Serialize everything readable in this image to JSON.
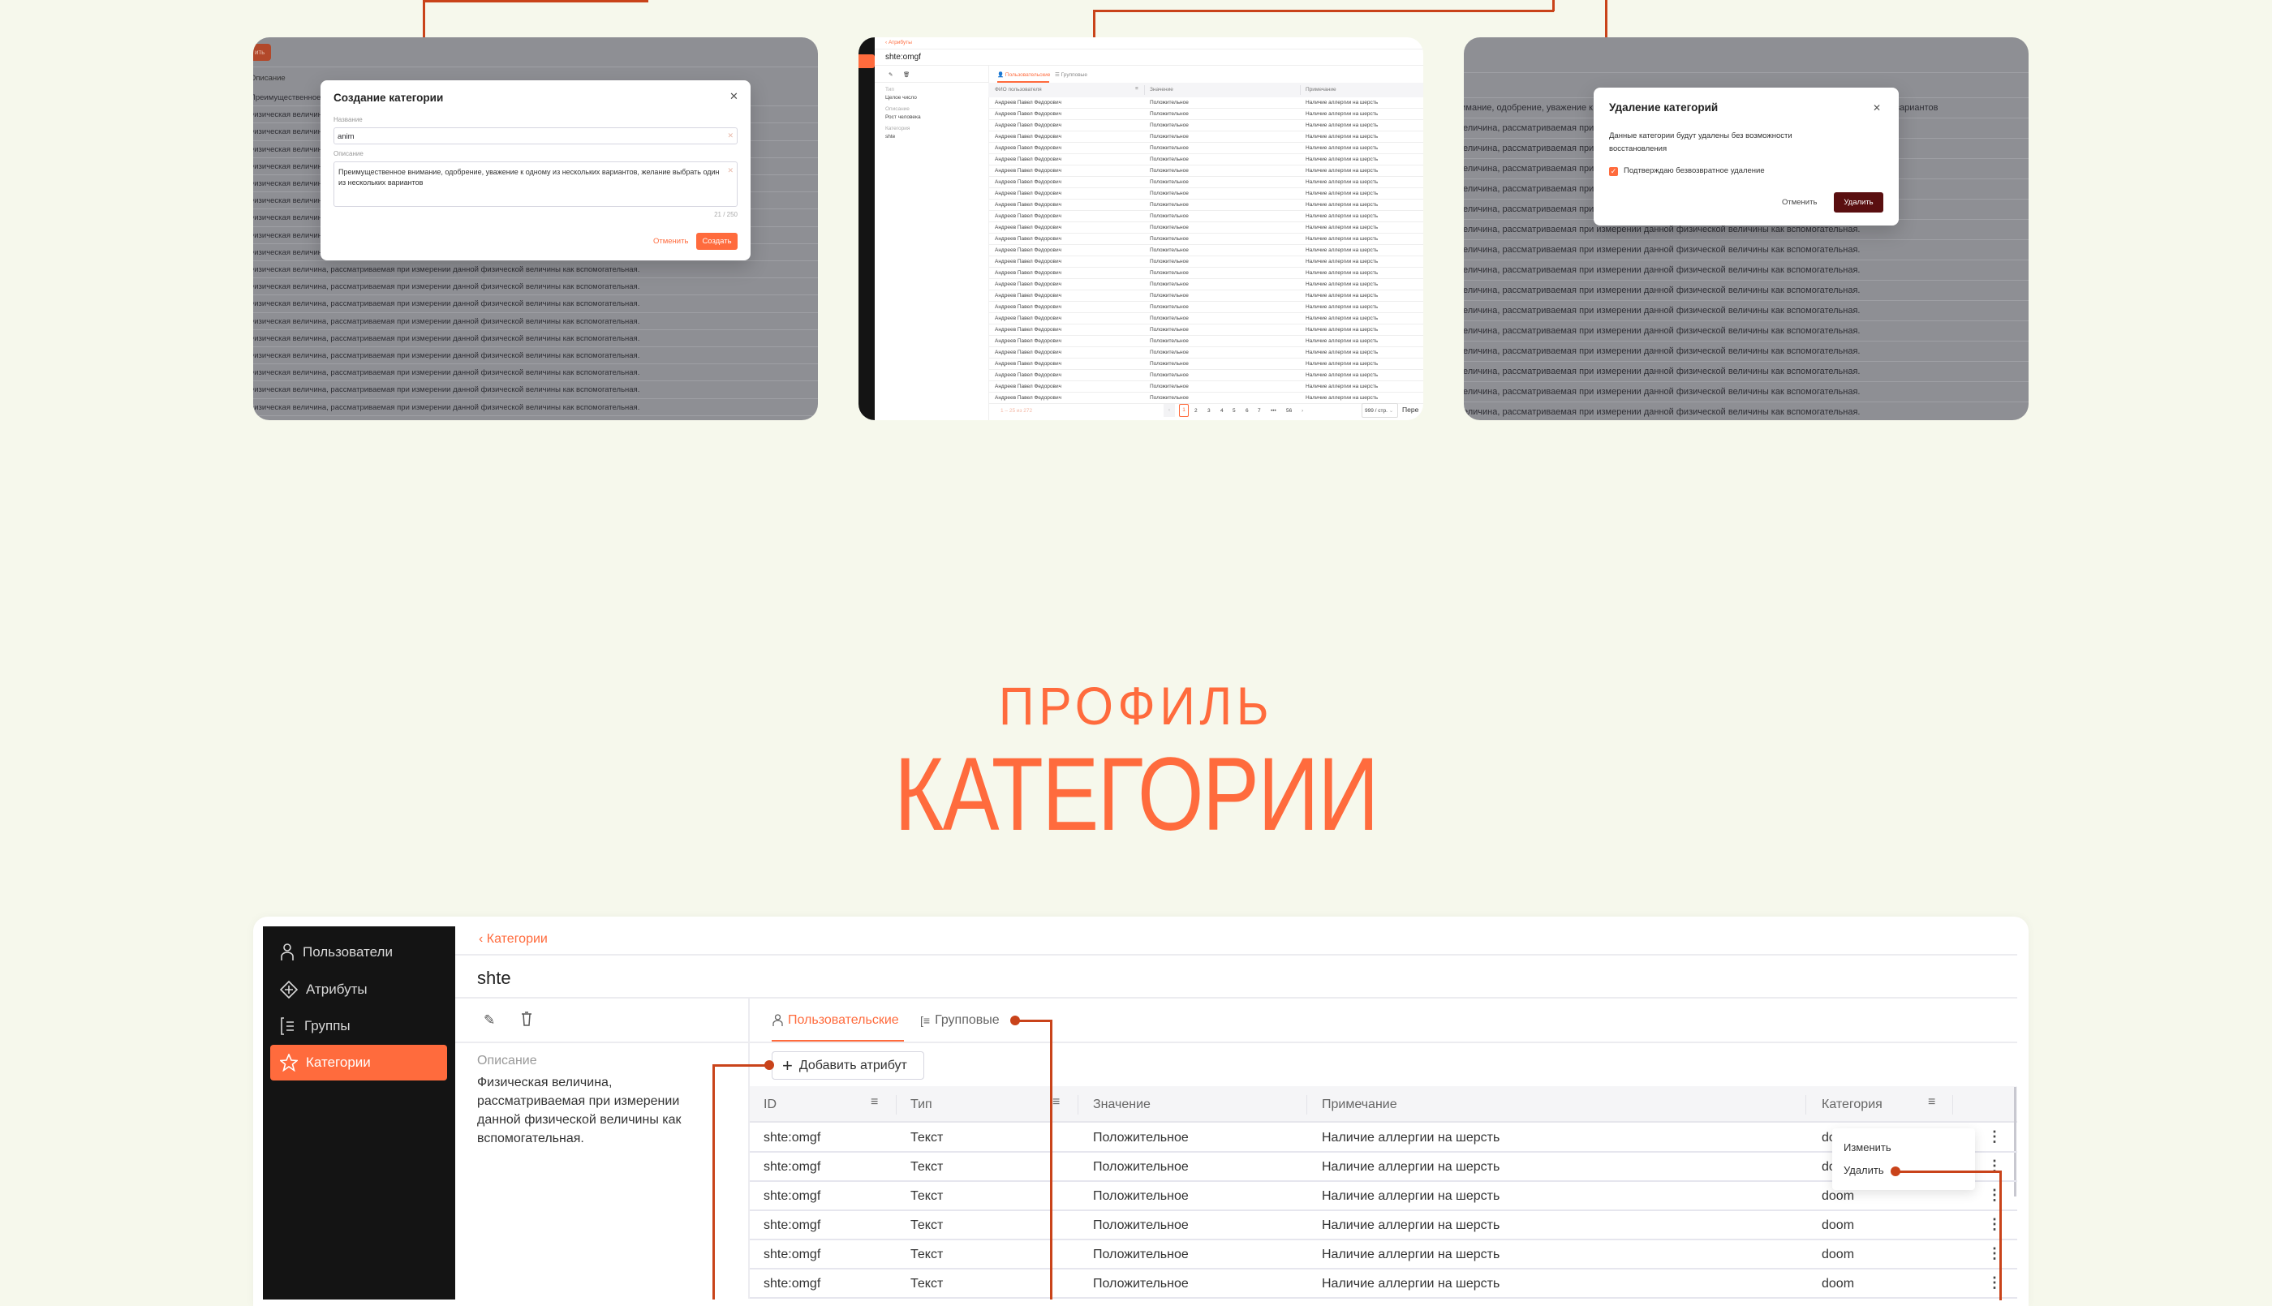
{
  "colors": {
    "accent": "#ff6b3d",
    "annotation": "#c9431a",
    "danger": "#5a0f10",
    "sidebar": "#141414",
    "background": "#f6f8ec"
  },
  "preview_create": {
    "bg_button_fragment": "ить",
    "bg_header": "Описание",
    "bg_rows": [
      "Преимущественное внимание, одобрение, уважение к одному из нескольких вариантов, желание выбрать один из нескольких вариантов",
      "Физическая величина, рассматриваемая при измерении данной физической величины как вспомогательная.",
      "Физическая величина, рассматриваемая при измерении данной физической величины как вспомогательная.",
      "Физическая величина, рассматриваемая при измерении данной физической величины как вспомогательная.",
      "Физическая величина, рассматриваемая при измерении данной физической величины как вспомогательная.",
      "Физическая величина, рассматриваемая при измерении данной физической величины как вспомогательная.",
      "Физическая величина, рассматриваемая при измерении данной физической величины как вспомогательная.",
      "Физическая величина, рассматриваемая при измерении данной физической величины как вспомогательная.",
      "Физическая величина, рассматриваемая при измерении данной физической величины как вспомогательная.",
      "Физическая величина, рассматриваемая при измерении данной физической величины как вспомогательная.",
      "Физическая величина, рассматриваемая при измерении данной физической величины как вспомогательная.",
      "Физическая величина, рассматриваемая при измерении данной физической величины как вспомогательная.",
      "Физическая величина, рассматриваемая при измерении данной физической величины как вспомогательная.",
      "Физическая величина, рассматриваемая при измерении данной физической величины как вспомогательная.",
      "Физическая величина, рассматриваемая при измерении данной физической величины как вспомогательная.",
      "Физическая величина, рассматриваемая при измерении данной физической величины как вспомогательная.",
      "Физическая величина, рассматриваемая при измерении данной физической величины как вспомогательная.",
      "Физическая величина, рассматриваемая при измерении данной физической величины как вспомогательная.",
      "Физическая величина, рассматриваемая при измерении данной физической величины как вспомогательная."
    ],
    "modal": {
      "title": "Создание категории",
      "name_label": "Название",
      "name_value": "anim",
      "desc_label": "Описание",
      "desc_value": "Преимущественное внимание, одобрение, уважение к одному из нескольких вариантов, желание выбрать один из нескольких вариантов",
      "counter": "21 / 250",
      "cancel": "Отменить",
      "create": "Создать"
    }
  },
  "preview_attribute": {
    "breadcrumb": "Атрибуты",
    "title": "shte:omgf",
    "details": [
      {
        "label": "Тип",
        "value": "Целое число"
      },
      {
        "label": "Описание",
        "value": "Рост человека"
      },
      {
        "label": "Категория",
        "value": "shte"
      }
    ],
    "tabs": [
      "Пользовательские",
      "Групповые"
    ],
    "columns": [
      "ФИО пользователя",
      "Значение",
      "Примечание"
    ],
    "rows": [
      [
        "Андреев Павел Федорович",
        "Положительное",
        "Наличие аллергии на шерсть"
      ],
      [
        "Андреев Павел Федорович",
        "Положительное",
        "Наличие аллергии на шерсть"
      ],
      [
        "Андреев Павел Федорович",
        "Положительное",
        "Наличие аллергии на шерсть"
      ],
      [
        "Андреев Павел Федорович",
        "Положительное",
        "Наличие аллергии на шерсть"
      ],
      [
        "Андреев Павел Федорович",
        "Положительное",
        "Наличие аллергии на шерсть"
      ],
      [
        "Андреев Павел Федорович",
        "Положительное",
        "Наличие аллергии на шерсть"
      ],
      [
        "Андреев Павел Федорович",
        "Положительное",
        "Наличие аллергии на шерсть"
      ],
      [
        "Андреев Павел Федорович",
        "Положительное",
        "Наличие аллергии на шерсть"
      ],
      [
        "Андреев Павел Федорович",
        "Положительное",
        "Наличие аллергии на шерсть"
      ],
      [
        "Андреев Павел Федорович",
        "Положительное",
        "Наличие аллергии на шерсть"
      ],
      [
        "Андреев Павел Федорович",
        "Положительное",
        "Наличие аллергии на шерсть"
      ],
      [
        "Андреев Павел Федорович",
        "Положительное",
        "Наличие аллергии на шерсть"
      ],
      [
        "Андреев Павел Федорович",
        "Положительное",
        "Наличие аллергии на шерсть"
      ],
      [
        "Андреев Павел Федорович",
        "Положительное",
        "Наличие аллергии на шерсть"
      ],
      [
        "Андреев Павел Федорович",
        "Положительное",
        "Наличие аллергии на шерсть"
      ],
      [
        "Андреев Павел Федорович",
        "Положительное",
        "Наличие аллергии на шерсть"
      ],
      [
        "Андреев Павел Федорович",
        "Положительное",
        "Наличие аллергии на шерсть"
      ],
      [
        "Андреев Павел Федорович",
        "Положительное",
        "Наличие аллергии на шерсть"
      ],
      [
        "Андреев Павел Федорович",
        "Положительное",
        "Наличие аллергии на шерсть"
      ],
      [
        "Андреев Павел Федорович",
        "Положительное",
        "Наличие аллергии на шерсть"
      ],
      [
        "Андреев Павел Федорович",
        "Положительное",
        "Наличие аллергии на шерсть"
      ],
      [
        "Андреев Павел Федорович",
        "Положительное",
        "Наличие аллергии на шерсть"
      ],
      [
        "Андреев Павел Федорович",
        "Положительное",
        "Наличие аллергии на шерсть"
      ],
      [
        "Андреев Павел Федорович",
        "Положительное",
        "Наличие аллергии на шерсть"
      ],
      [
        "Андреев Павел Федорович",
        "Положительное",
        "Наличие аллергии на шерсть"
      ],
      [
        "Андреев Павел Федорович",
        "Положительное",
        "Наличие аллергии на шерсть"
      ],
      [
        "Андреев Павел Федорович",
        "Положительное",
        "Наличие аллергии на шерсть"
      ]
    ],
    "pagination": {
      "summary": "1 – 25 из 272",
      "pages": [
        "1",
        "2",
        "3",
        "4",
        "5",
        "6",
        "7",
        "•••",
        "56"
      ],
      "current": "1",
      "page_size": "999 / стр.",
      "goto": "Пере"
    }
  },
  "preview_delete": {
    "bg_rows": [
      "Преимущественное внимание, одобрение, уважение к одному из нескольких вариантов, желание выбрать один из нескольких вариантов",
      "Физическая величина, рассматриваемая при измерении данной физической величины как вспомогательная.",
      "Физическая величина, рассматриваемая при измерении данной физической величины как вспомогательная.",
      "Физическая величина, рассматриваемая при измерении данной физической величины как вспомогательная.",
      "Физическая величина, рассматриваемая при измерении данной физической величины как вспомогательная.",
      "Физическая величина, рассматриваемая при измерении данной физической величины как вспомогательная.",
      "Физическая величина, рассматриваемая при измерении данной физической величины как вспомогательная.",
      "Физическая величина, рассматриваемая при измерении данной физической величины как вспомогательная.",
      "Физическая величина, рассматриваемая при измерении данной физической величины как вспомогательная.",
      "Физическая величина, рассматриваемая при измерении данной физической величины как вспомогательная.",
      "Физическая величина, рассматриваемая при измерении данной физической величины как вспомогательная.",
      "Физическая величина, рассматриваемая при измерении данной физической величины как вспомогательная.",
      "Физическая величина, рассматриваемая при измерении данной физической величины как вспомогательная.",
      "Физическая величина, рассматриваемая при измерении данной физической величины как вспомогательная.",
      "Физическая величина, рассматриваемая при измерении данной физической величины как вспомогательная.",
      "Физическая величина, рассматриваемая при измерении данной физической величины как вспомогательная."
    ],
    "modal": {
      "title": "Удаление категорий",
      "text": "Данные категории будут удалены без возможности восстановления",
      "confirm_label": "Подтверждаю безвозвратное удаление",
      "confirm_checked": true,
      "cancel": "Отменить",
      "delete": "Удалить"
    }
  },
  "heading": {
    "line1": "ПРОФИЛЬ",
    "line2": "КАТЕГОРИИ"
  },
  "app": {
    "sidebar": [
      {
        "label": "Пользователи",
        "icon": "user-icon"
      },
      {
        "label": "Атрибуты",
        "icon": "attribute-icon"
      },
      {
        "label": "Группы",
        "icon": "group-icon"
      },
      {
        "label": "Категории",
        "icon": "star-icon",
        "active": true
      }
    ],
    "breadcrumb": "Категории",
    "title": "shte",
    "desc_label": "Описание",
    "desc_lines": [
      "Физическая величина,",
      "рассматриваемая при измерении",
      "данной физической величины как",
      "вспомогательная."
    ],
    "tabs": [
      "Пользовательские",
      "Групповые"
    ],
    "add_button": "Добавить атрибут",
    "columns": [
      "ID",
      "Тип",
      "Значение",
      "Примечание",
      "Категория"
    ],
    "rows": [
      [
        "shte:omgf",
        "Текст",
        "Положительное",
        "Наличие аллергии на шерсть",
        "doom"
      ],
      [
        "shte:omgf",
        "Текст",
        "Положительное",
        "Наличие аллергии на шерсть",
        "doom"
      ],
      [
        "shte:omgf",
        "Текст",
        "Положительное",
        "Наличие аллергии на шерсть",
        "doom"
      ],
      [
        "shte:omgf",
        "Текст",
        "Положительное",
        "Наличие аллергии на шерсть",
        "doom"
      ],
      [
        "shte:omgf",
        "Текст",
        "Положительное",
        "Наличие аллергии на шерсть",
        "doom"
      ],
      [
        "shte:omgf",
        "Текст",
        "Положительное",
        "Наличие аллергии на шерсть",
        "doom"
      ]
    ],
    "row_menu": [
      "Изменить",
      "Удалить"
    ]
  }
}
